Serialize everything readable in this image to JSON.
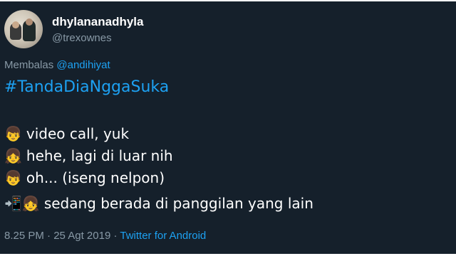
{
  "user": {
    "display_name": "dhylananadhyla",
    "handle": "@trexownes"
  },
  "reply": {
    "prefix": "Membalas",
    "mention": "@andihiyat"
  },
  "tweet": {
    "hashtag": "#TandaDiaNggaSuka",
    "lines": [
      {
        "emoji": "👦",
        "text": "video call, yuk"
      },
      {
        "emoji": "👧",
        "text": "hehe, lagi di luar nih"
      },
      {
        "emoji": "👦",
        "text": "oh... (iseng nelpon)"
      },
      {
        "emoji": "📲👧",
        "text": "sedang berada di panggilan yang lain"
      }
    ]
  },
  "meta": {
    "time": "8.25 PM",
    "separator": "·",
    "date": "25 Agt 2019",
    "source": "Twitter for Android"
  },
  "colors": {
    "background": "#15202b",
    "text": "#ffffff",
    "muted": "#8899a6",
    "link": "#1da1f2"
  }
}
